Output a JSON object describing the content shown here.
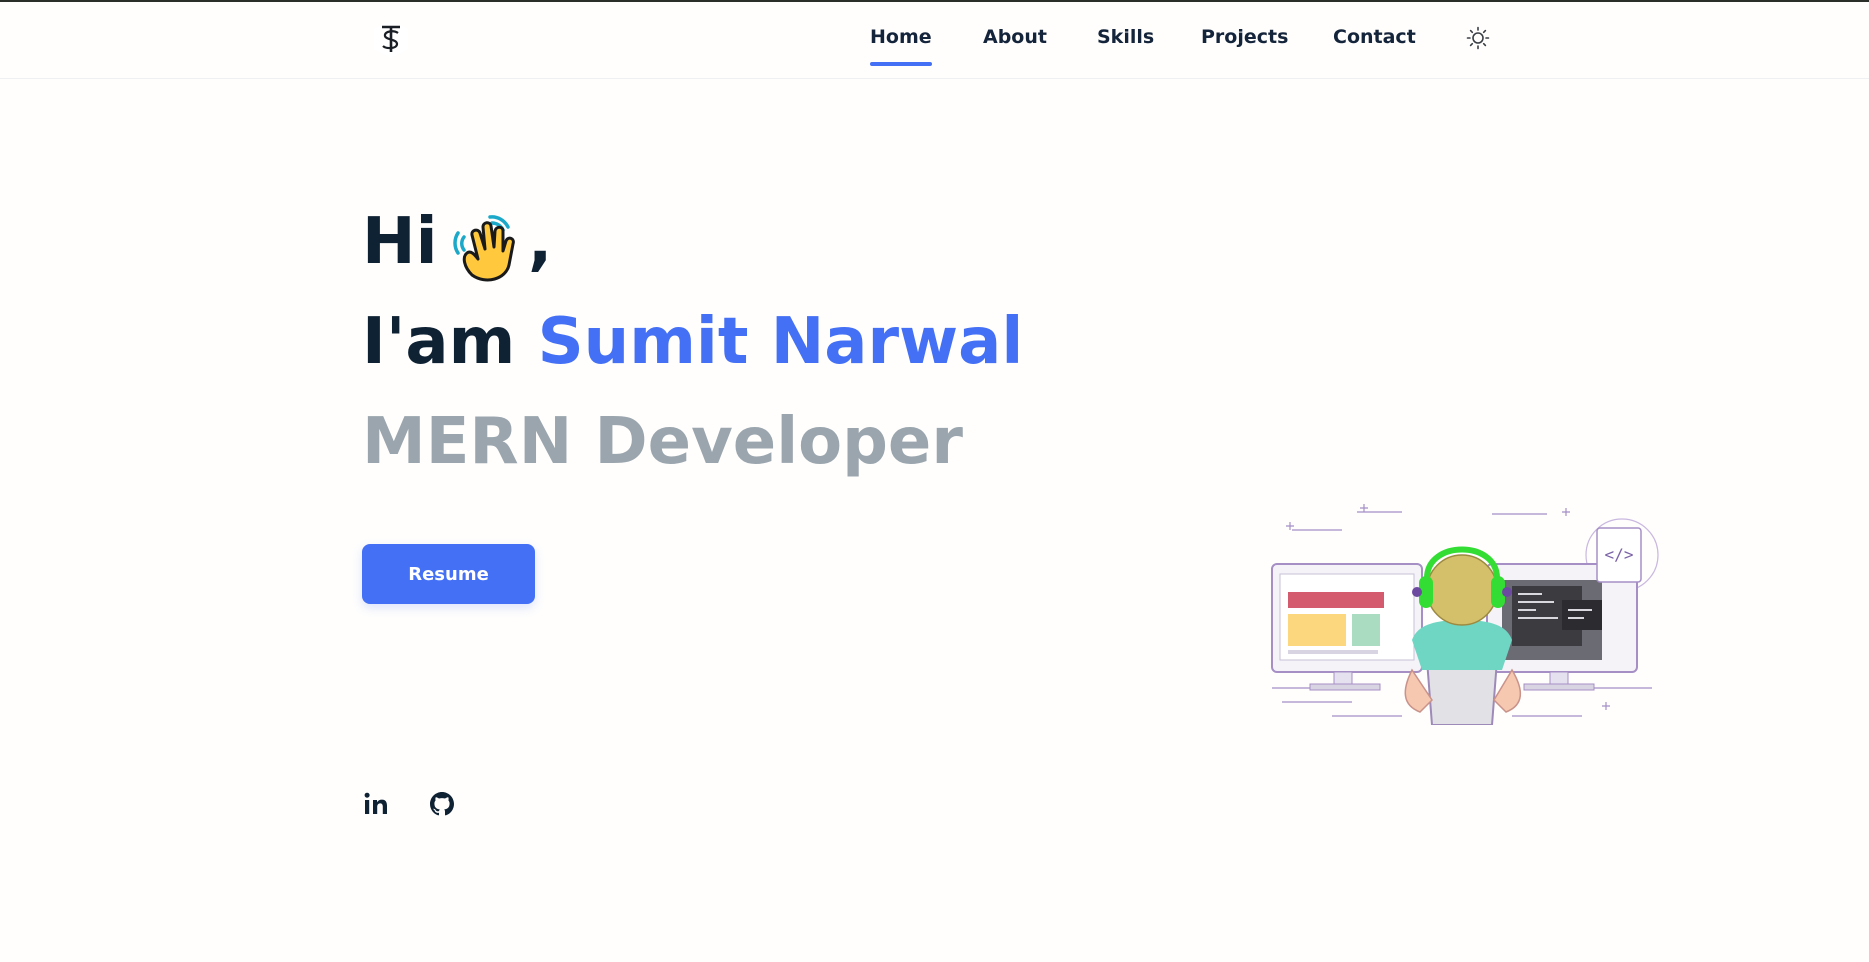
{
  "brand": {
    "logo_icon": "ts-monogram-logo"
  },
  "nav": {
    "items": [
      {
        "label": "Home",
        "active": true
      },
      {
        "label": "About",
        "active": false
      },
      {
        "label": "Skills",
        "active": false
      },
      {
        "label": "Projects",
        "active": false
      },
      {
        "label": "Contact",
        "active": false
      }
    ],
    "theme_toggle_icon": "sun-icon"
  },
  "hero": {
    "greeting": "Hi",
    "wave_emoji": "👋",
    "comma": ",",
    "intro_prefix": "I'am",
    "name": "Sumit Narwal",
    "role": "MERN Developer",
    "resume_label": "Resume"
  },
  "social": [
    {
      "icon": "linkedin-icon",
      "label": "in"
    },
    {
      "icon": "github-icon"
    }
  ],
  "colors": {
    "accent": "#4470f5",
    "heading": "#0f2233",
    "muted": "#9aa5ad",
    "background": "#fffefd"
  }
}
